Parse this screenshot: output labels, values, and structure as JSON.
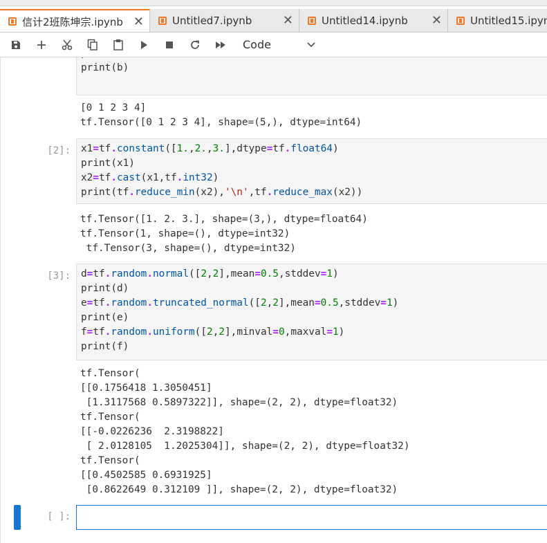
{
  "tabs": [
    {
      "label": "信计2班陈坤宗.ipynb",
      "active": true
    },
    {
      "label": "Untitled7.ipynb",
      "active": false
    },
    {
      "label": "Untitled14.ipynb",
      "active": false
    },
    {
      "label": "Untitled15.ipynb",
      "active": false
    }
  ],
  "toolbar": {
    "cell_type": "Code"
  },
  "cells": {
    "c1_code_prev": "print(a)",
    "c1_code_1": "print(b)",
    "c1_out_1": "[0 1 2 3 4]",
    "c1_out_2": "tf.Tensor([0 1 2 3 4], shape=(5,), dtype=int64)",
    "c2_prompt": "[2]:",
    "c2_out_1": "tf.Tensor([1. 2. 3.], shape=(3,), dtype=float64)",
    "c2_out_2": "tf.Tensor(1, shape=(), dtype=int32)",
    "c2_out_3": " tf.Tensor(3, shape=(), dtype=int32)",
    "c3_prompt": "[3]:",
    "c3_out_1": "tf.Tensor(",
    "c3_out_2": "[[0.1756418 1.3050451]",
    "c3_out_3": " [1.3117568 0.5897322]], shape=(2, 2), dtype=float32)",
    "c3_out_4": "tf.Tensor(",
    "c3_out_5": "[[-0.0226236  2.3198822]",
    "c3_out_6": " [ 2.0128105  1.2025304]], shape=(2, 2), dtype=float32)",
    "c3_out_7": "tf.Tensor(",
    "c3_out_8": "[[0.4502585 0.6931925]",
    "c3_out_9": " [0.8622649 0.312109 ]], shape=(2, 2), dtype=float32)",
    "c4_prompt": "[ ]:"
  },
  "colors": {
    "accent": "#f37726",
    "active": "#1976d2",
    "keyword": "#aa22ff",
    "number": "#008000",
    "string": "#ba2121"
  },
  "icons": [
    "save-icon",
    "add-icon",
    "cut-icon",
    "copy-icon",
    "paste-icon",
    "run-icon",
    "stop-icon",
    "restart-icon",
    "fast-forward-icon",
    "chevron-down-icon"
  ]
}
